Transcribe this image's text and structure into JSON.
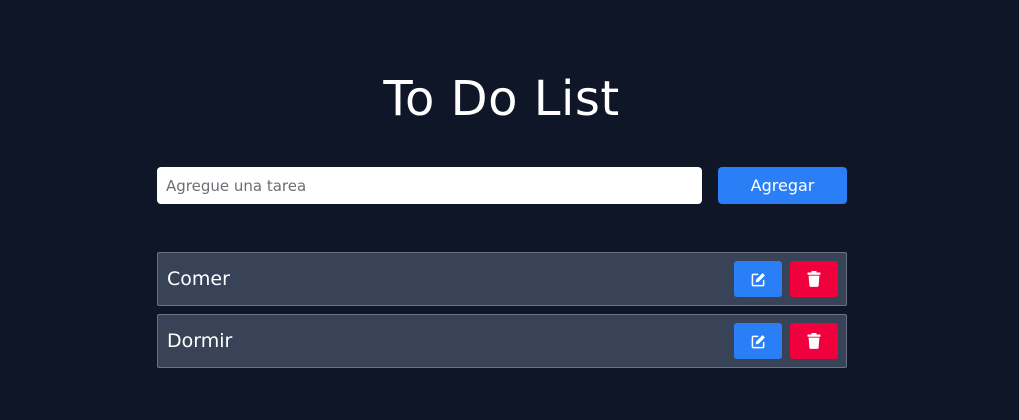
{
  "page": {
    "title": "To Do List"
  },
  "form": {
    "input_value": "",
    "input_placeholder": "Agregue una tarea",
    "add_label": "Agregar"
  },
  "tasks": [
    {
      "label": "Comer",
      "edit_icon": "edit-icon",
      "delete_icon": "trash-icon"
    },
    {
      "label": "Dormir",
      "edit_icon": "edit-icon",
      "delete_icon": "trash-icon"
    }
  ],
  "colors": {
    "background": "#0e1628",
    "accent_blue": "#2b7ff6",
    "danger_red": "#f0003c",
    "task_bg": "#394357"
  }
}
